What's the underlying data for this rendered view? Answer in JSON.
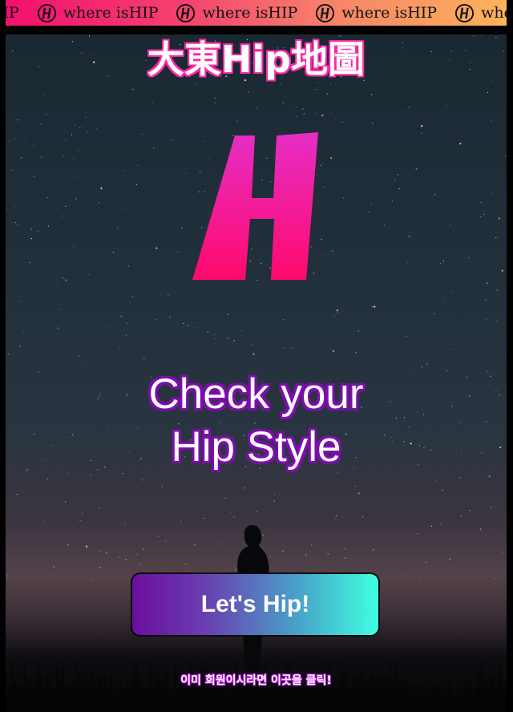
{
  "banner": {
    "text": "where isHIP",
    "items": [
      "where isHIP",
      "where isHIP",
      "where isHIP",
      "where isHIP"
    ],
    "lead_text": "isHIP",
    "colors": [
      "#f3106f",
      "#fcb35a"
    ]
  },
  "header": {
    "title": "大東Hip地圖"
  },
  "hero": {
    "logo_icon": "brand-h-logo",
    "logo_colors": [
      "#e52ec4",
      "#ff0a6e"
    ],
    "headline_line1": "Check your",
    "headline_line2": "Hip Style"
  },
  "actions": {
    "cta_label": "Let's Hip!",
    "login_link": "이미 회원이시라면 이곳을 클릭!"
  },
  "theme": {
    "accent_purple": "#7b0fa8",
    "accent_pink": "#ff2aa8",
    "cta_gradient": [
      "#6a0f9e",
      "#3effe0"
    ]
  }
}
